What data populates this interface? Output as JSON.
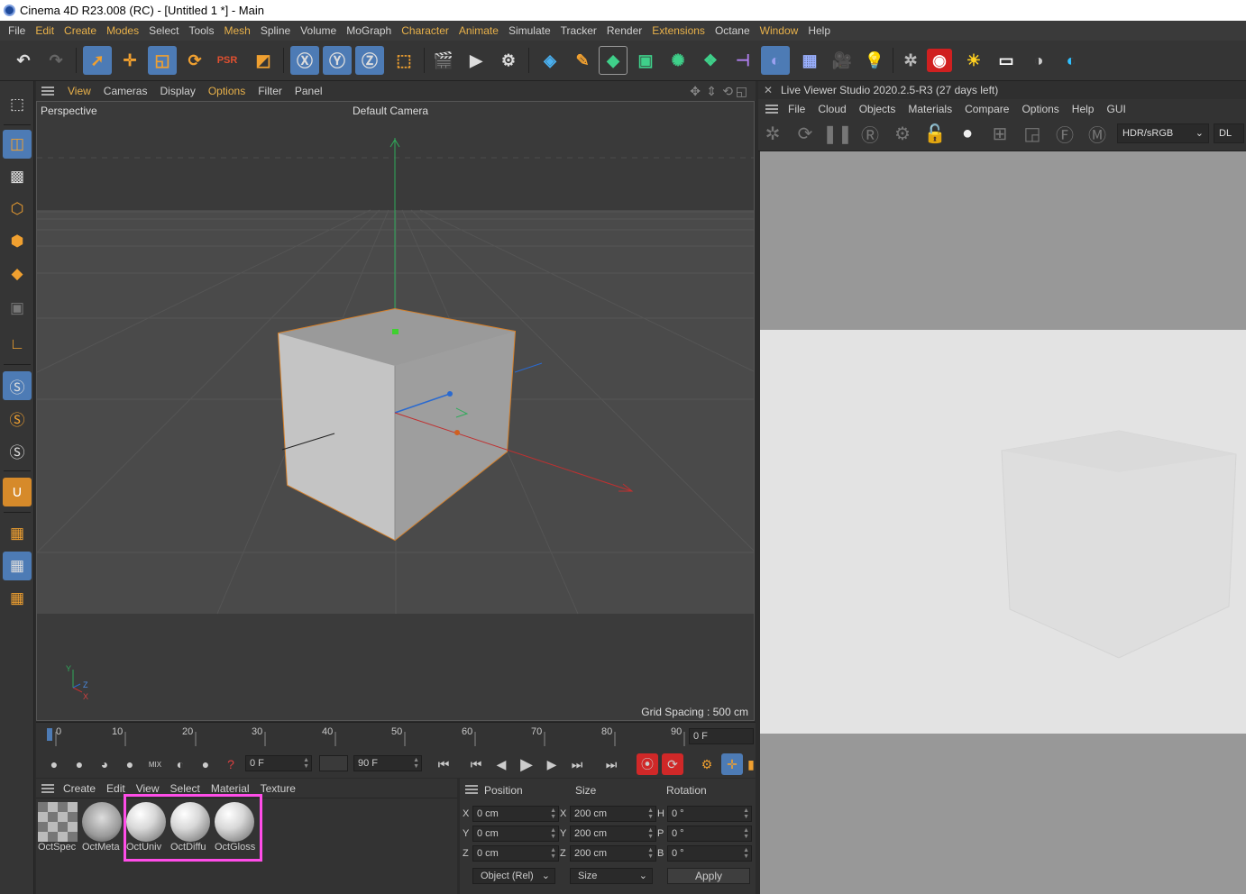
{
  "app": {
    "title": "Cinema 4D R23.008 (RC) - [Untitled 1 *] - Main"
  },
  "menu": [
    "File",
    "Edit",
    "Create",
    "Modes",
    "Select",
    "Tools",
    "Mesh",
    "Spline",
    "Volume",
    "MoGraph",
    "Character",
    "Animate",
    "Simulate",
    "Tracker",
    "Render",
    "Extensions",
    "Octane",
    "Window",
    "Help"
  ],
  "viewport": {
    "menu": [
      "View",
      "Cameras",
      "Display",
      "Options",
      "Filter",
      "Panel"
    ],
    "label": "Perspective",
    "camera": "Default Camera",
    "grid_spacing": "Grid Spacing : 500 cm",
    "axis": {
      "y": "Y",
      "z": "Z",
      "x": "X"
    }
  },
  "live_viewer": {
    "title": "Live Viewer Studio 2020.2.5-R3 (27 days left)",
    "menu": [
      "File",
      "Cloud",
      "Objects",
      "Materials",
      "Compare",
      "Options",
      "Help",
      "GUI"
    ],
    "color_mode": "HDR/sRGB",
    "mode_label": "DL"
  },
  "timeline": {
    "ticks": [
      "0",
      "10",
      "20",
      "30",
      "40",
      "50",
      "60",
      "70",
      "80",
      "90"
    ],
    "current_frame": "0 F"
  },
  "playback": {
    "start": "0 F",
    "end": "90 F"
  },
  "materials": {
    "menu": [
      "Create",
      "Edit",
      "View",
      "Select",
      "Material",
      "Texture"
    ],
    "items": [
      "OctSpec",
      "OctMeta",
      "OctUniv",
      "OctDiffu",
      "OctGloss"
    ]
  },
  "coords": {
    "headers": {
      "position": "Position",
      "size": "Size",
      "rotation": "Rotation"
    },
    "rows": [
      {
        "pos_axis": "X",
        "pos": "0 cm",
        "size_axis": "X",
        "size": "200 cm",
        "rot_axis": "H",
        "rot": "0 °"
      },
      {
        "pos_axis": "Y",
        "pos": "0 cm",
        "size_axis": "Y",
        "size": "200 cm",
        "rot_axis": "P",
        "rot": "0 °"
      },
      {
        "pos_axis": "Z",
        "pos": "0 cm",
        "size_axis": "Z",
        "size": "200 cm",
        "rot_axis": "B",
        "rot": "0 °"
      }
    ],
    "mode": "Object (Rel)",
    "size_mode": "Size",
    "apply": "Apply"
  },
  "colors": {
    "accent": "#4d7bb5",
    "selection": "#d68a2a",
    "highlight": "#ff4de8",
    "menu_highlight": "#e8b14a"
  }
}
